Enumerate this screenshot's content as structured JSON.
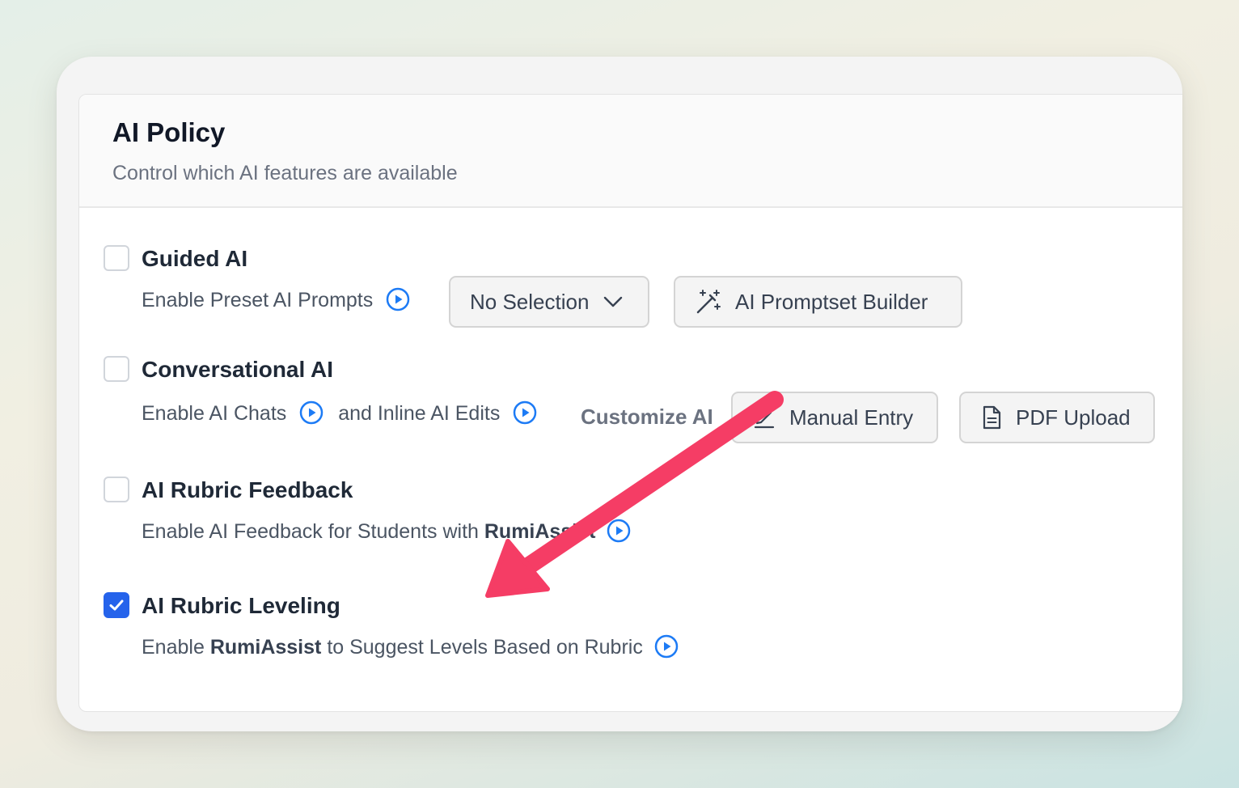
{
  "header": {
    "title": "AI Policy",
    "subtitle": "Control which AI features are available"
  },
  "options": {
    "guided": {
      "title": "Guided AI",
      "checked": false,
      "description": "Enable Preset AI Prompts",
      "dropdown_value": "No Selection",
      "builder_button": "AI Promptset Builder"
    },
    "conversational": {
      "title": "Conversational AI",
      "checked": false,
      "description_part1": "Enable AI Chats",
      "description_part2": "and Inline AI Edits",
      "customize_label": "Customize AI",
      "manual_entry_button": "Manual Entry",
      "pdf_upload_button": "PDF Upload"
    },
    "feedback": {
      "title": "AI Rubric Feedback",
      "checked": false,
      "description_prefix": "Enable AI Feedback for Students with",
      "description_brand": "RumiAssist"
    },
    "leveling": {
      "title": "AI Rubric Leveling",
      "checked": true,
      "description_prefix": "Enable",
      "description_brand": "RumiAssist",
      "description_suffix": "to Suggest Levels Based on Rubric"
    }
  },
  "colors": {
    "accent": "#2563eb",
    "play_icon": "#1d7bf5",
    "annotation_arrow": "#f53d65"
  },
  "icons": [
    "play-circle-icon",
    "chevron-down-icon",
    "magic-wand-icon",
    "pencil-icon",
    "document-icon",
    "checkmark-icon"
  ]
}
